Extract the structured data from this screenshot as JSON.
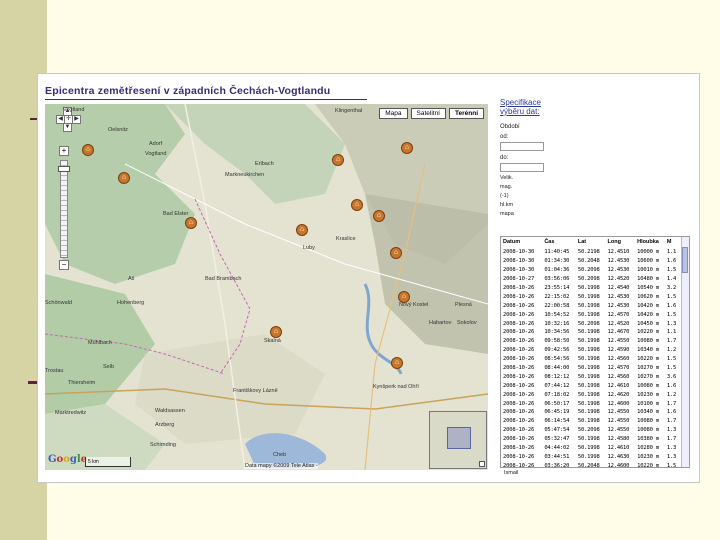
{
  "page": {
    "title": "Epicentra zemětřesení v západních Čechách-Vogtlandu"
  },
  "colors": {
    "slide_background": "#fffde7",
    "left_strip": "#d6d3a4",
    "title": "#3a2a7a",
    "link": "#2a3aa0",
    "epicenter_marker": "#c8772a"
  },
  "map": {
    "type_buttons": [
      "Mapa",
      "Satelitní",
      "Terénní"
    ],
    "active_type": "Terénní",
    "copyright": "Data mapy ©2009 Tele Atlas -",
    "scale_label": "5 km",
    "places": [
      "Vogtland",
      "Oelsnitz",
      "Adorf",
      "Vogtland",
      "Markneukirchen",
      "Erlbach",
      "Bad Elster",
      "Aš",
      "Bad Brambach",
      "Luby",
      "Kraslice",
      "Klingenthal",
      "Nový Kostel",
      "Plesná",
      "Skalná",
      "Cheb",
      "Františkovy Lázně",
      "Sokolov",
      "Habartov",
      "Kynšperk nad Ohří",
      "Schönwald",
      "Selb",
      "Marktredwitz",
      "Waldsassen",
      "Schirnding",
      "Arzberg",
      "Mühlbach",
      "Trostau",
      "Thiersheim",
      "Hohenberg"
    ],
    "overview_toggle_icon": "collapse-icon"
  },
  "side_panel": {
    "spec_link": "Specifikace výběru dat:",
    "obdobi_label": "Období",
    "od_label": "od:",
    "do_label": "do:",
    "extra_labels": [
      "Velik.",
      "mag.",
      "(-1)",
      "hl.km",
      "mapa"
    ]
  },
  "results": {
    "headers": [
      "Datum",
      "Čas",
      "Lat",
      "Long",
      "Hloubka",
      "M"
    ],
    "rows": [
      [
        "2008-10-30",
        "11:40:45",
        "50.2198",
        "12.4510",
        "10000 m",
        "1.1"
      ],
      [
        "2008-10-30",
        "01:34:30",
        "50.2048",
        "12.4530",
        "10600 m",
        "1.6"
      ],
      [
        "2008-10-30",
        "01:04:36",
        "50.2098",
        "12.4530",
        "10010 m",
        "1.5"
      ],
      [
        "2008-10-27",
        "03:56:06",
        "50.2098",
        "12.4520",
        "10480 m",
        "1.4"
      ],
      [
        "2008-10-26",
        "23:55:14",
        "50.1998",
        "12.4540",
        "10540 m",
        "3.2"
      ],
      [
        "2008-10-26",
        "22:15:02",
        "50.1998",
        "12.4530",
        "10620 m",
        "1.5"
      ],
      [
        "2008-10-26",
        "22:00:58",
        "50.1998",
        "12.4530",
        "10420 m",
        "1.6"
      ],
      [
        "2008-10-26",
        "10:54:52",
        "50.1998",
        "12.4570",
        "10420 m",
        "1.5"
      ],
      [
        "2008-10-26",
        "10:32:16",
        "50.2098",
        "12.4520",
        "10450 m",
        "1.3"
      ],
      [
        "2008-10-26",
        "10:34:56",
        "50.1998",
        "12.4670",
        "10220 m",
        "1.1"
      ],
      [
        "2008-10-26",
        "09:58:50",
        "50.1998",
        "12.4550",
        "10080 m",
        "1.7"
      ],
      [
        "2008-10-26",
        "09:42:56",
        "50.1998",
        "12.4590",
        "10340 m",
        "1.2"
      ],
      [
        "2008-10-26",
        "08:54:56",
        "50.1998",
        "12.4560",
        "10220 m",
        "1.5"
      ],
      [
        "2008-10-26",
        "08:44:00",
        "50.1998",
        "12.4570",
        "10270 m",
        "1.5"
      ],
      [
        "2008-10-26",
        "08:12:12",
        "50.1998",
        "12.4560",
        "10270 m",
        "3.6"
      ],
      [
        "2008-10-26",
        "07:44:12",
        "50.1998",
        "12.4610",
        "10080 m",
        "1.6"
      ],
      [
        "2008-10-26",
        "07:18:02",
        "50.1998",
        "12.4620",
        "10230 m",
        "1.2"
      ],
      [
        "2008-10-26",
        "06:50:17",
        "50.1998",
        "12.4600",
        "10100 m",
        "1.7"
      ],
      [
        "2008-10-26",
        "06:45:19",
        "50.1998",
        "12.4550",
        "10340 m",
        "1.6"
      ],
      [
        "2008-10-26",
        "06:14:54",
        "50.1998",
        "12.4550",
        "10080 m",
        "1.7"
      ],
      [
        "2008-10-26",
        "05:47:54",
        "50.2098",
        "12.4550",
        "10080 m",
        "1.3"
      ],
      [
        "2008-10-26",
        "05:32:47",
        "50.1998",
        "12.4580",
        "10380 m",
        "1.7"
      ],
      [
        "2008-10-26",
        "04:44:02",
        "50.1998",
        "12.4610",
        "10280 m",
        "1.3"
      ],
      [
        "2008-10-26",
        "03:44:51",
        "50.1998",
        "12.4630",
        "10230 m",
        "1.3"
      ],
      [
        "2008-10-26",
        "03:36:20",
        "50.2048",
        "12.4600",
        "10220 m",
        "1.5"
      ]
    ],
    "footer": "Ismail"
  }
}
